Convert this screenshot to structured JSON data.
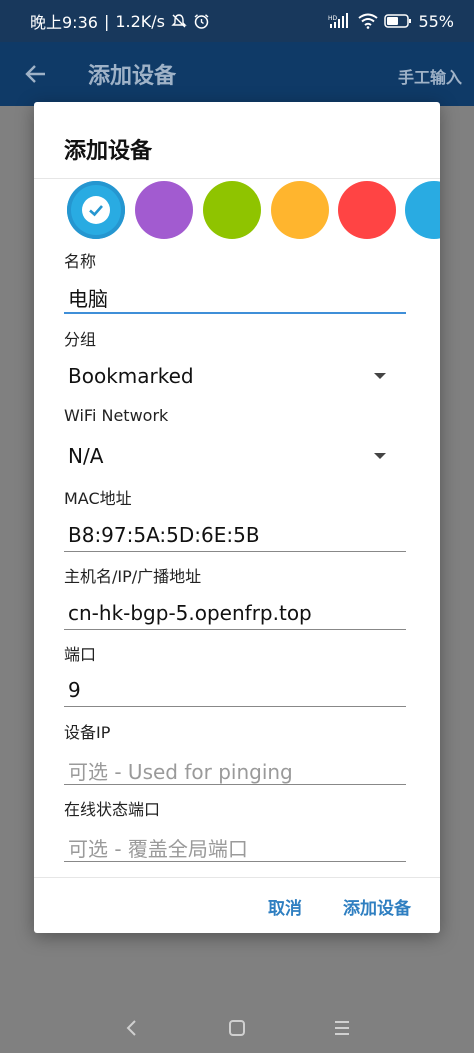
{
  "status_bar": {
    "time": "晚上9:36",
    "network_speed": "1.2K/s",
    "battery": "55%",
    "icons": [
      "mute-icon",
      "alarm-icon",
      "signal-icon",
      "wifi-icon",
      "battery-icon"
    ]
  },
  "app_bar": {
    "title": "添加设备",
    "action": "手工输入",
    "back_icon": "back-arrow-icon"
  },
  "dialog": {
    "title": "添加设备",
    "colors": [
      "#29abe2",
      "#a25bd0",
      "#8fc400",
      "#ffb52e",
      "#ff4444",
      "#29abe2"
    ],
    "selected_color_index": 0,
    "fields": {
      "name": {
        "label": "名称",
        "value": "电脑"
      },
      "group": {
        "label": "分组",
        "value": "Bookmarked"
      },
      "wifi": {
        "label": "WiFi Network",
        "value": "N/A"
      },
      "mac": {
        "label": "MAC地址",
        "value": "B8:97:5A:5D:6E:5B"
      },
      "host": {
        "label": "主机名/IP/广播地址",
        "value": "cn-hk-bgp-5.openfrp.top"
      },
      "port": {
        "label": "端口",
        "value": "9"
      },
      "device_ip": {
        "label": "设备IP",
        "placeholder": "可选 - Used for pinging"
      },
      "online_port": {
        "label": "在线状态端口",
        "placeholder": "可选 - 覆盖全局端口"
      }
    },
    "cancel": "取消",
    "confirm": "添加设备"
  },
  "nav_bar": {
    "icons": [
      "back-icon",
      "home-icon",
      "menu-icon"
    ]
  }
}
